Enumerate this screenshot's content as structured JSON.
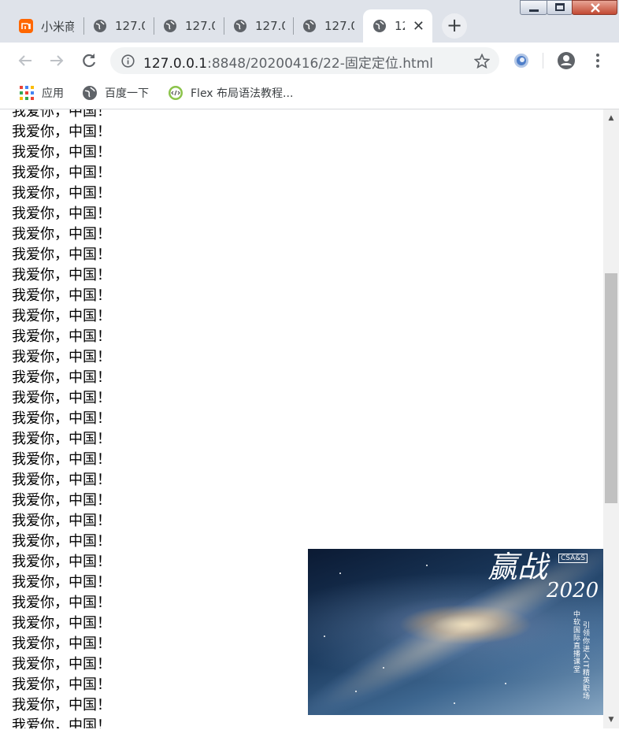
{
  "tabs": [
    {
      "label": "小米商",
      "favicon": "mi-icon"
    },
    {
      "label": "127.0",
      "favicon": "globe-icon"
    },
    {
      "label": "127.0",
      "favicon": "globe-icon"
    },
    {
      "label": "127.0",
      "favicon": "globe-icon"
    },
    {
      "label": "127.0",
      "favicon": "globe-icon"
    },
    {
      "label": "12",
      "favicon": "globe-icon",
      "active": true
    }
  ],
  "new_tab_label": "+",
  "close_tab_glyph": "✕",
  "address_bar": {
    "host": "127.0.0.1",
    "path": ":8848/20200416/22-固定定位.html"
  },
  "bookmarks": [
    {
      "label": "应用",
      "icon": "apps-grid-icon"
    },
    {
      "label": "百度一下",
      "icon": "globe-icon"
    },
    {
      "label": "Flex 布局语法教程...",
      "icon": "flex-icon"
    }
  ],
  "page": {
    "line_text": "我爱你，中国！",
    "line_count": 31
  },
  "fixed_image": {
    "calligraphy": "赢战",
    "year": "2020",
    "logo": "CSA&S",
    "vertical_left": "中软国际直播课堂",
    "vertical_right": "引领你进入IT精英职场"
  },
  "colors": {
    "tab_strip": "#dfe3ea",
    "omnibox": "#f1f3f4",
    "scroll_thumb": "#c1c1c1"
  }
}
